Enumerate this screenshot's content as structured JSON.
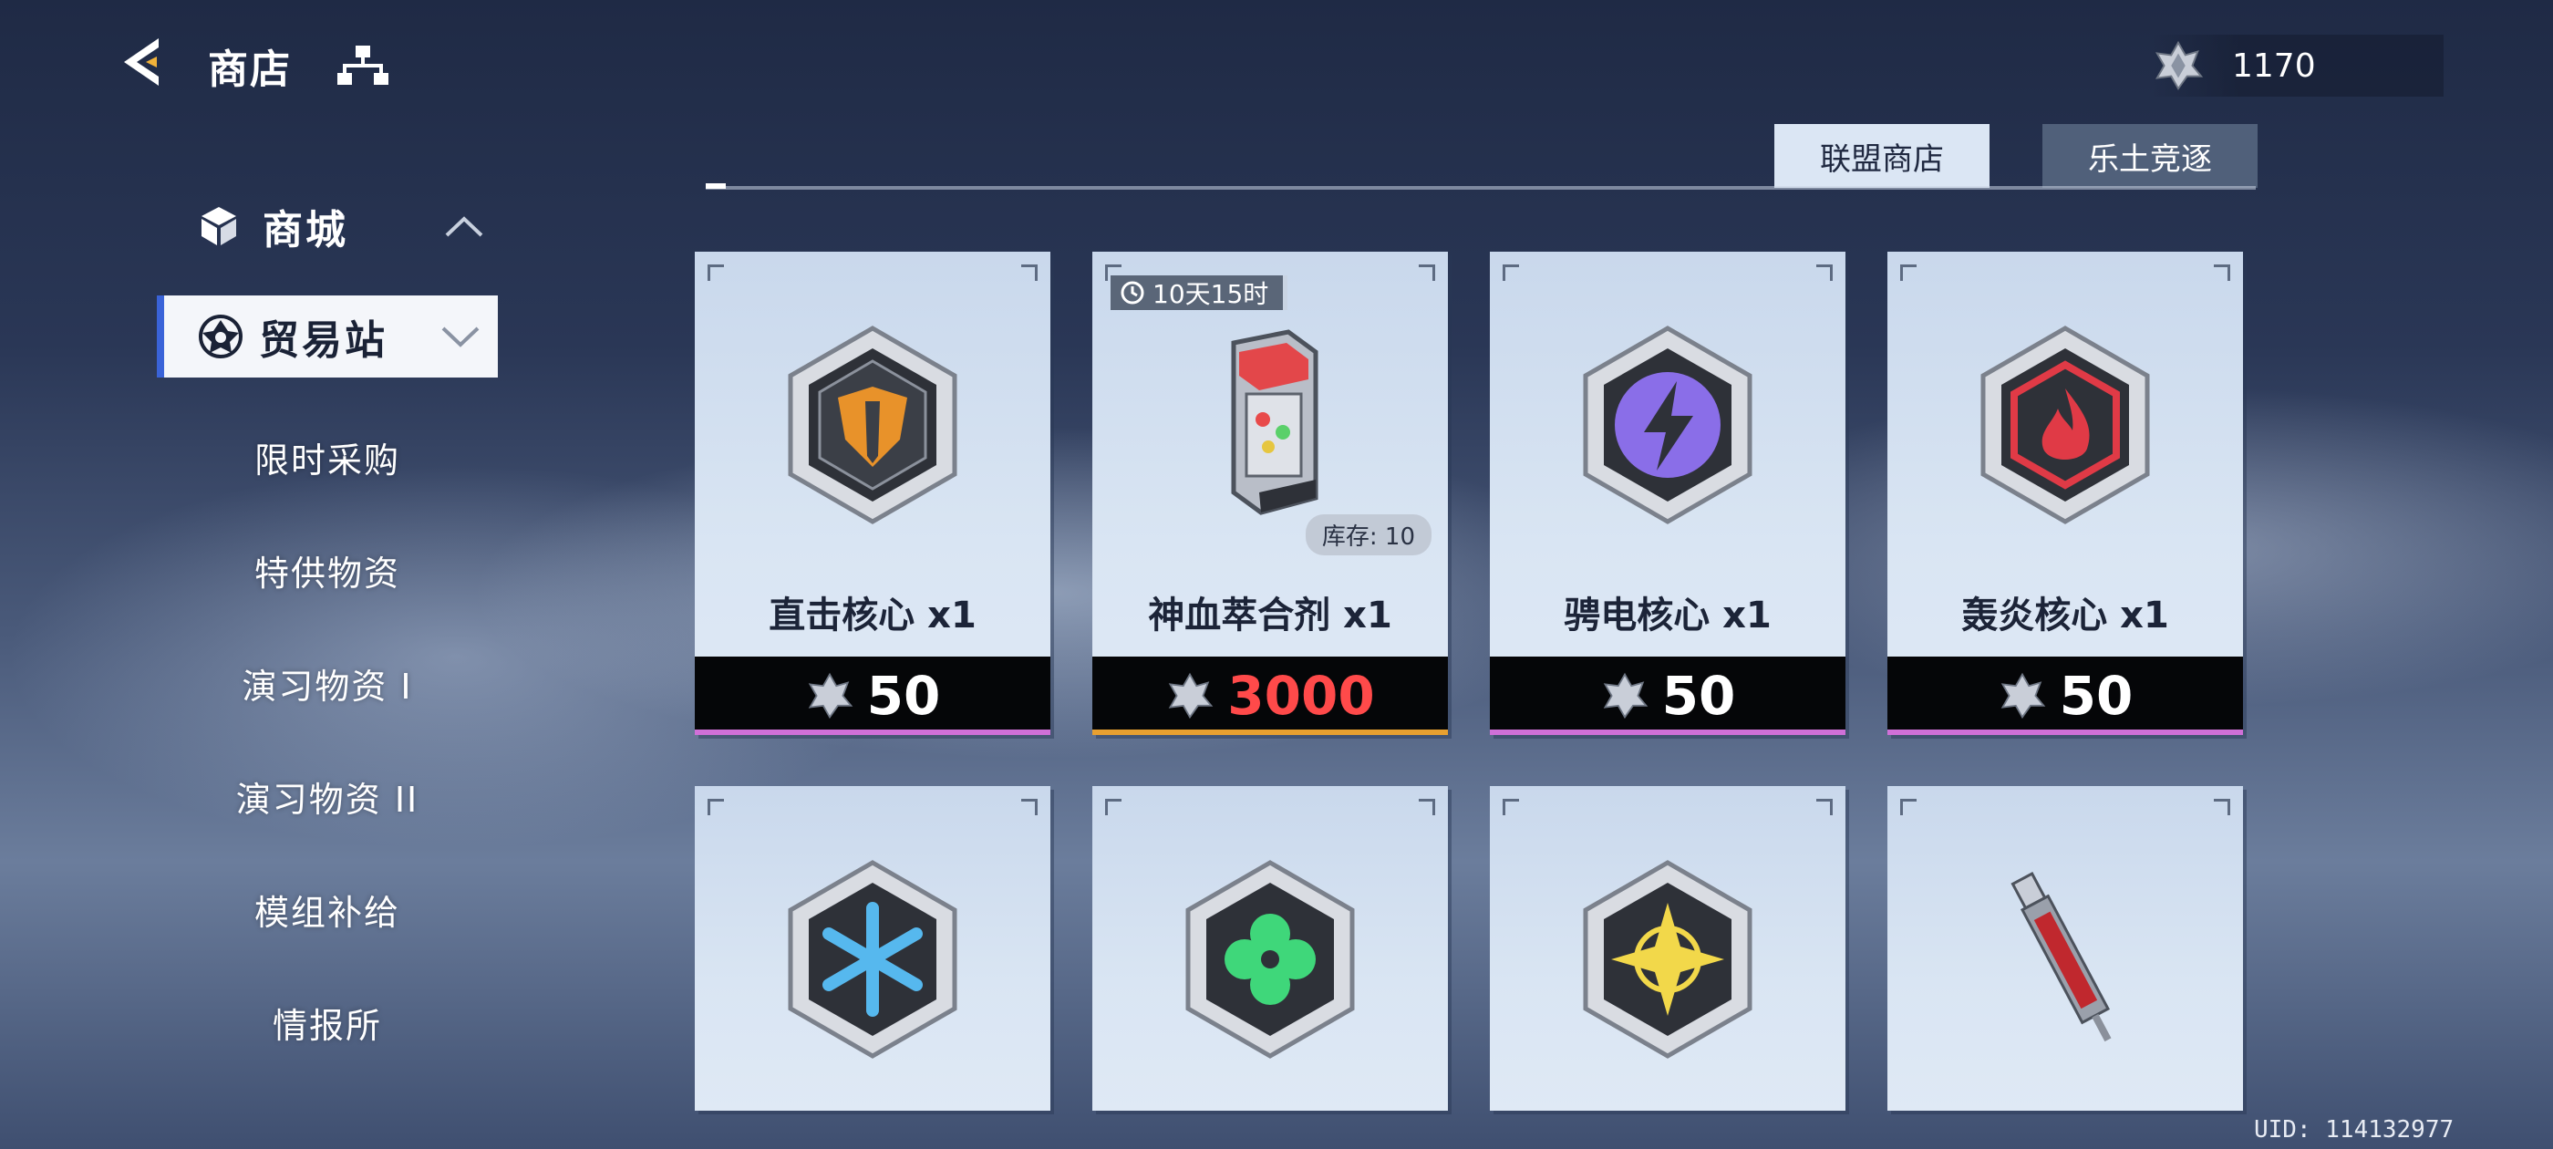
{
  "header": {
    "title": "商店",
    "currency_value": "1170"
  },
  "tabs": [
    {
      "label": "联盟商店",
      "active": true
    },
    {
      "label": "乐土竞逐",
      "active": false
    }
  ],
  "sidebar": {
    "category": "商城",
    "selected": "贸易站",
    "items": [
      "限时采购",
      "特供物资",
      "演习物资 I",
      "演习物资 II",
      "模组补给",
      "情报所"
    ]
  },
  "cards": [
    {
      "name": "直击核心 x1",
      "price": "50",
      "accent": "#d070d8",
      "icon": "orange-sword-core-icon",
      "color": "#e8922a"
    },
    {
      "name": "神血萃合剂 x1",
      "price": "3000",
      "price_color": "#ff4a4a",
      "accent": "#e8a030",
      "timer": "10天15时",
      "stock": "库存: 10",
      "icon": "blood-canister-icon"
    },
    {
      "name": "骋电核心 x1",
      "price": "50",
      "accent": "#d070d8",
      "icon": "purple-lightning-core-icon",
      "color": "#8a6ee8"
    },
    {
      "name": "轰炎核心 x1",
      "price": "50",
      "accent": "#d070d8",
      "icon": "red-flame-core-icon",
      "color": "#e03a46"
    },
    {
      "icon": "blue-snowflake-core-icon",
      "color": "#56b8ee"
    },
    {
      "icon": "green-clover-core-icon",
      "color": "#3fd77a"
    },
    {
      "icon": "yellow-star-core-icon",
      "color": "#f2d84a"
    },
    {
      "icon": "red-syringe-icon"
    }
  ],
  "uid": "UID: 114132977"
}
